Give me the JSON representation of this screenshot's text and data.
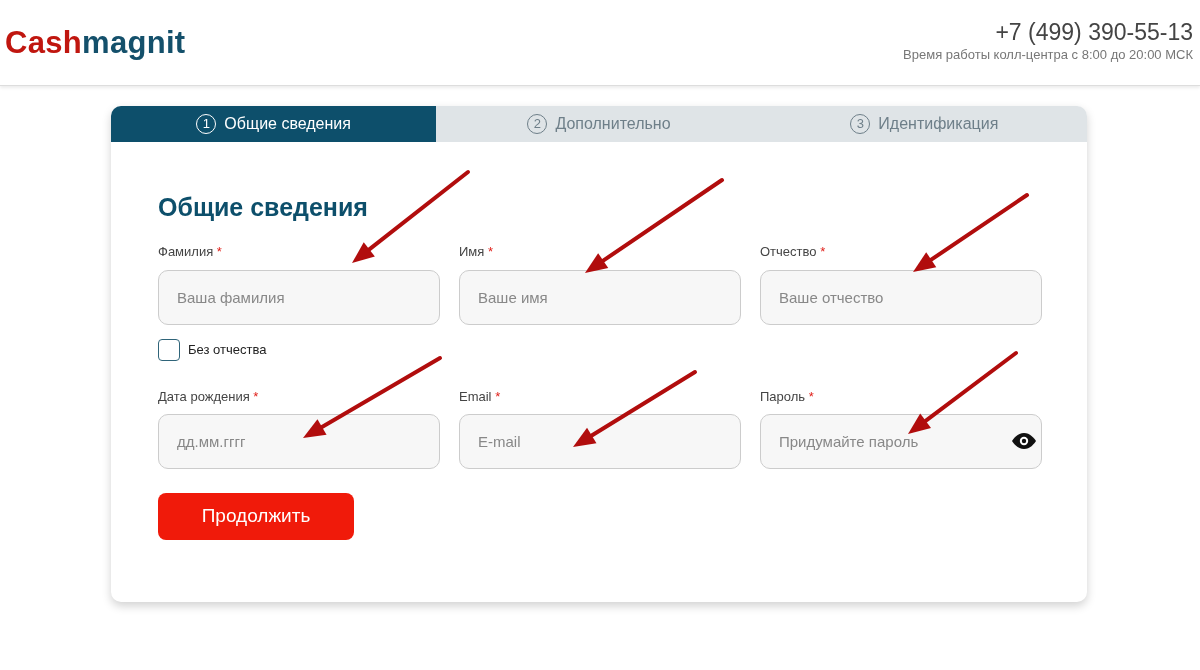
{
  "header": {
    "logo": {
      "first": "Cash",
      "second": "magnit"
    },
    "phone": "+7 (499) 390-55-13",
    "hours": "Время работы колл-центра с 8:00 до 20:00 МСК"
  },
  "steps": [
    {
      "number": "1",
      "label": "Общие сведения",
      "selected": true
    },
    {
      "number": "2",
      "label": "Дополнительно",
      "selected": false
    },
    {
      "number": "3",
      "label": "Идентификация",
      "selected": false
    }
  ],
  "form": {
    "title": "Общие сведения",
    "rows": [
      [
        {
          "label": "Фамилия",
          "required_mark": "*",
          "placeholder": "Ваша фамилия",
          "kind": "text"
        },
        {
          "label": "Имя",
          "required_mark": "*",
          "placeholder": "Ваше имя",
          "kind": "text"
        },
        {
          "label": "Отчество",
          "required_mark": "*",
          "placeholder": "Ваше отчество",
          "kind": "text"
        }
      ],
      [
        {
          "label": "Дата рождения",
          "required_mark": "*",
          "placeholder": "дд.мм.гггг",
          "kind": "text"
        },
        {
          "label": "Email",
          "required_mark": "*",
          "placeholder": "E-mail",
          "kind": "text"
        },
        {
          "label": "Пароль",
          "required_mark": "*",
          "placeholder": "Придумайте пароль",
          "kind": "password"
        }
      ]
    ],
    "checkbox": {
      "label": "Без отчества",
      "checked": false
    },
    "submit": "Продолжить"
  }
}
